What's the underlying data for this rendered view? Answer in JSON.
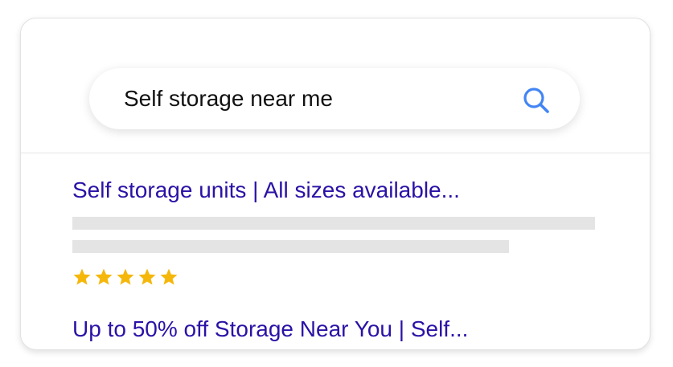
{
  "search": {
    "query": "Self storage near me",
    "icon": "search-icon"
  },
  "results": [
    {
      "title": "Self storage units | All sizes available...",
      "rating": {
        "value": 5,
        "max": 5
      }
    },
    {
      "title": "Up to 50% off Storage Near You | Self..."
    }
  ],
  "colors": {
    "link": "#2a12a6",
    "search_icon": "#4285f4",
    "star": "#f5b70a",
    "placeholder_line": "#e4e4e4"
  }
}
